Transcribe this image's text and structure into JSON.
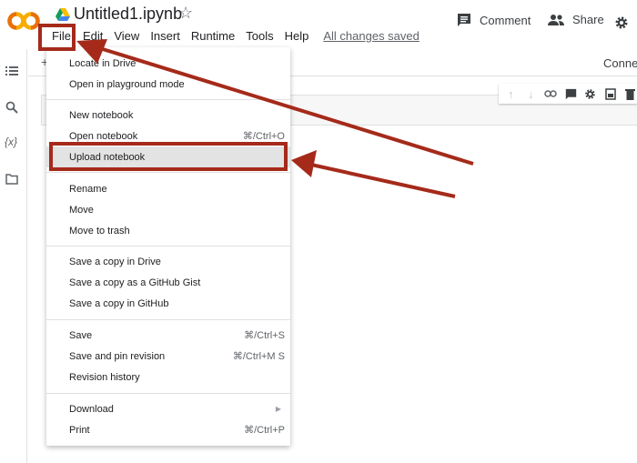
{
  "header": {
    "doc_title": "Untitled1.ipynb",
    "comment_label": "Comment",
    "share_label": "Share"
  },
  "menubar": {
    "items": [
      "File",
      "Edit",
      "View",
      "Insert",
      "Runtime",
      "Tools",
      "Help"
    ],
    "status": "All changes saved"
  },
  "toolbar": {
    "add_label": "+",
    "connect_label": "Connect"
  },
  "file_menu": {
    "items": [
      {
        "label": "Locate in Drive",
        "shortcut": ""
      },
      {
        "label": "Open in playground mode",
        "shortcut": ""
      },
      {
        "label": "New notebook",
        "shortcut": ""
      },
      {
        "label": "Open notebook",
        "shortcut": "⌘/Ctrl+O"
      },
      {
        "label": "Upload notebook",
        "shortcut": ""
      },
      {
        "label": "Rename",
        "shortcut": ""
      },
      {
        "label": "Move",
        "shortcut": ""
      },
      {
        "label": "Move to trash",
        "shortcut": ""
      },
      {
        "label": "Save a copy in Drive",
        "shortcut": ""
      },
      {
        "label": "Save a copy as a GitHub Gist",
        "shortcut": ""
      },
      {
        "label": "Save a copy in GitHub",
        "shortcut": ""
      },
      {
        "label": "Save",
        "shortcut": "⌘/Ctrl+S"
      },
      {
        "label": "Save and pin revision",
        "shortcut": "⌘/Ctrl+M S"
      },
      {
        "label": "Revision history",
        "shortcut": ""
      },
      {
        "label": "Download",
        "shortcut": ""
      },
      {
        "label": "Print",
        "shortcut": "⌘/Ctrl+P"
      }
    ]
  },
  "icons": {
    "logo": "colab-logo",
    "drive": "drive-icon",
    "star": "star-icon",
    "comment": "comment-icon",
    "share": "people-icon",
    "settings": "gear-icon",
    "toc": "list-icon",
    "search": "search-icon",
    "variables": "variables-icon",
    "files": "folder-icon"
  },
  "colors": {
    "logo_orange": "#F9AB00",
    "logo_dark": "#E8710A",
    "annotation_red": "#A52A1A",
    "highlight": "#E3E3E3"
  }
}
